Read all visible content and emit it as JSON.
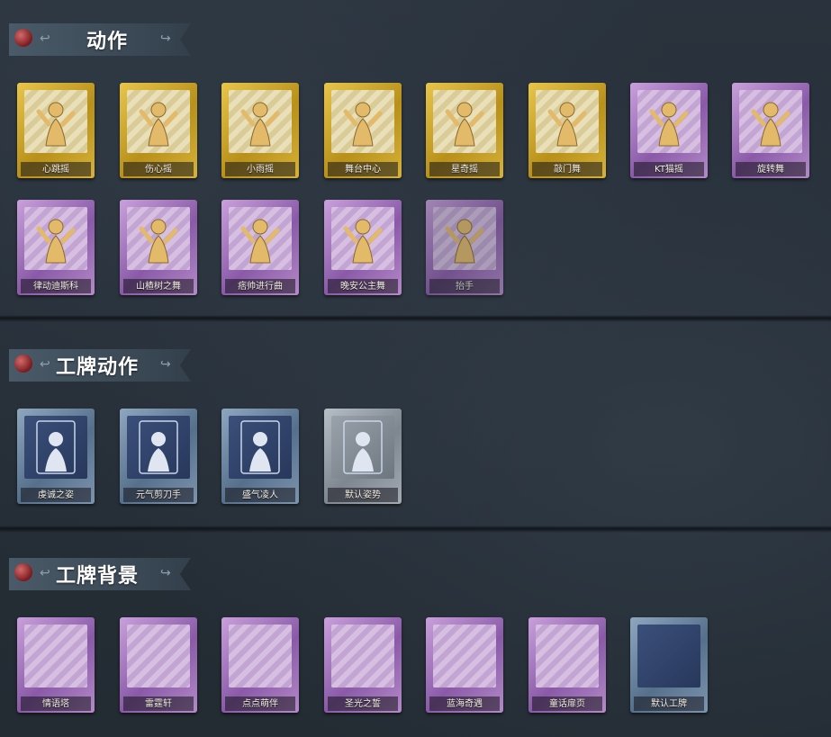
{
  "sections": {
    "actions": {
      "title": "动作",
      "items": [
        {
          "label": "心跳摇",
          "tier": "gold"
        },
        {
          "label": "伤心摇",
          "tier": "gold"
        },
        {
          "label": "小雨摇",
          "tier": "gold"
        },
        {
          "label": "舞台中心",
          "tier": "gold"
        },
        {
          "label": "星奇摇",
          "tier": "gold"
        },
        {
          "label": "敲门舞",
          "tier": "gold"
        },
        {
          "label": "KT猫摇",
          "tier": "purple"
        },
        {
          "label": "旋转舞",
          "tier": "purple"
        },
        {
          "label": "律动迪斯科",
          "tier": "purple"
        },
        {
          "label": "山楂树之舞",
          "tier": "purple"
        },
        {
          "label": "痞帅进行曲",
          "tier": "purple"
        },
        {
          "label": "晚安公主舞",
          "tier": "purple"
        },
        {
          "label": "抬手",
          "tier": "purple",
          "locked": true
        }
      ]
    },
    "badge_actions": {
      "title": "工牌动作",
      "items": [
        {
          "label": "虔诚之姿",
          "tier": "blue"
        },
        {
          "label": "元气剪刀手",
          "tier": "blue"
        },
        {
          "label": "盛气凌人",
          "tier": "blue"
        },
        {
          "label": "默认姿势",
          "tier": "grey"
        }
      ]
    },
    "badge_backgrounds": {
      "title": "工牌背景",
      "items": [
        {
          "label": "情语塔",
          "tier": "purple"
        },
        {
          "label": "雷霆轩",
          "tier": "purple"
        },
        {
          "label": "点点萌伴",
          "tier": "purple"
        },
        {
          "label": "圣光之誓",
          "tier": "purple"
        },
        {
          "label": "蓝海奇遇",
          "tier": "purple"
        },
        {
          "label": "童话扉页",
          "tier": "purple"
        },
        {
          "label": "默认工牌",
          "tier": "blue"
        }
      ]
    }
  },
  "colors": {
    "gold_frame": "#d6b23a",
    "purple_frame": "#b48ac8",
    "blue_frame": "#7d94ae",
    "grey_frame": "#a2aab2",
    "banner": "#3d4b58",
    "pin": "#a5282d"
  },
  "icons": {
    "banner_pin": "red-pushpin-icon",
    "banner_swirl": "swirl-ornament-icon",
    "action_figure": "dancing-figure-silhouette-icon"
  }
}
